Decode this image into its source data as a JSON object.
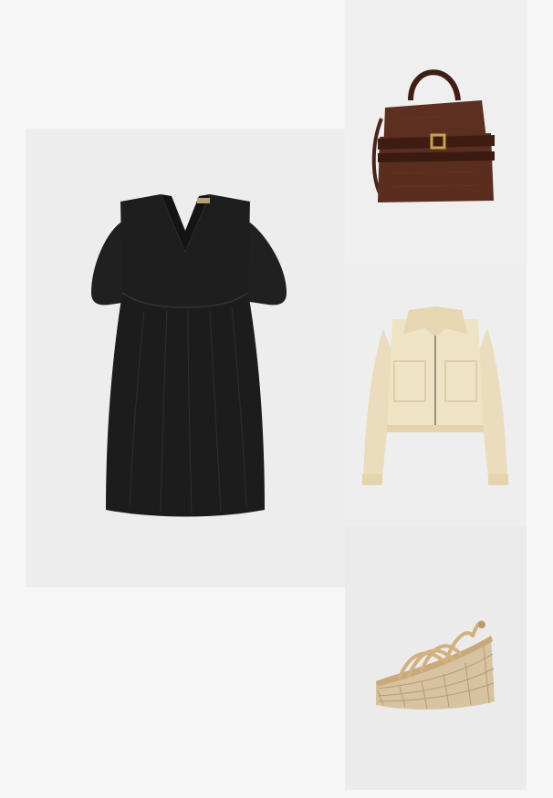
{
  "outfit": {
    "items": [
      {
        "id": "dress",
        "icon": "black-puff-sleeve-dress",
        "color": "#222222"
      },
      {
        "id": "bag",
        "icon": "brown-suede-handbag",
        "color": "#5a2e1f"
      },
      {
        "id": "jacket",
        "icon": "cream-boucle-jacket",
        "color": "#eee1c2"
      },
      {
        "id": "shoe",
        "icon": "woven-espadrille-wedge",
        "color": "#d5b88f"
      }
    ]
  }
}
